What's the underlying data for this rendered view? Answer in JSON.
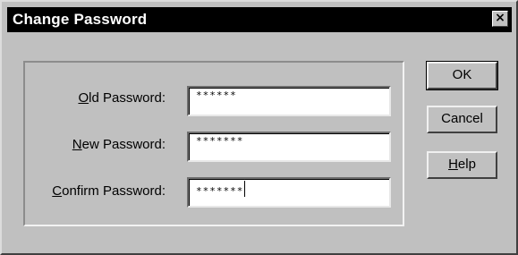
{
  "dialog": {
    "title": "Change Password",
    "close_glyph": "×"
  },
  "fields": [
    {
      "label_mnemonic": "O",
      "label_rest": "ld Password:",
      "value": "******"
    },
    {
      "label_mnemonic": "N",
      "label_rest": "ew Password:",
      "value": "*******"
    },
    {
      "label_mnemonic": "C",
      "label_rest": "onfirm Password:",
      "value": "*******"
    }
  ],
  "buttons": {
    "ok": "OK",
    "cancel": "Cancel",
    "help_mnemonic": "H",
    "help_rest": "elp"
  },
  "icons": {
    "close": "close-icon"
  },
  "colors": {
    "face": "#c0c0c0",
    "titlebar": "#000000",
    "title_text": "#ffffff"
  }
}
